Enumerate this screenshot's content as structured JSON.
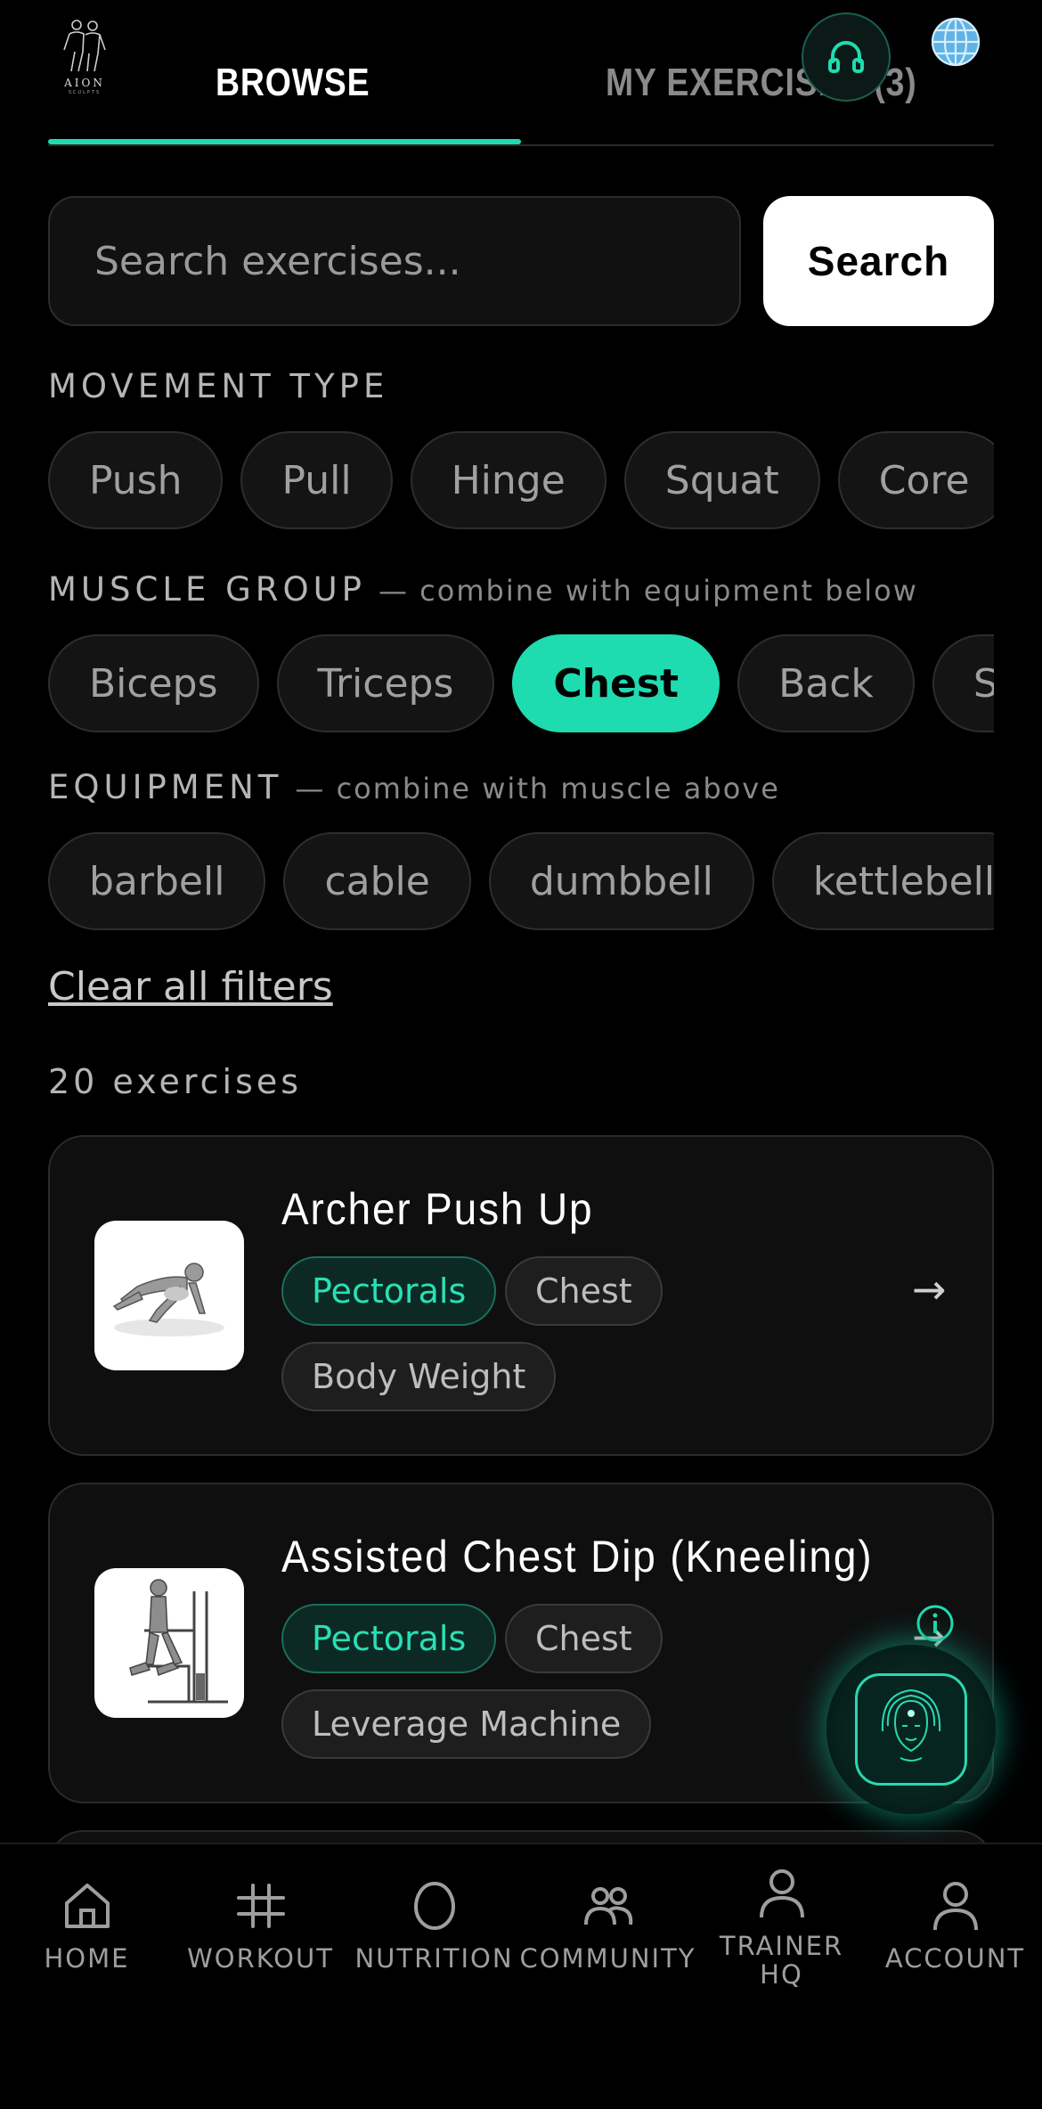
{
  "header": {
    "logo_text": "AION",
    "logo_subtext": "SCULPTS",
    "tabs": [
      {
        "label": "BROWSE",
        "active": true
      },
      {
        "label": "MY EXERCISES (3)",
        "active": false
      }
    ],
    "accent_color": "#1fdcb0"
  },
  "search": {
    "placeholder": "Search exercises...",
    "value": "",
    "button_label": "Search"
  },
  "filters": {
    "movement": {
      "label": "MOVEMENT TYPE",
      "chips": [
        "Push",
        "Pull",
        "Hinge",
        "Squat",
        "Core"
      ]
    },
    "muscle": {
      "label": "MUSCLE GROUP",
      "hint": "— combine with equipment below",
      "chips": [
        "Biceps",
        "Triceps",
        "Chest",
        "Back",
        "Shoulders"
      ],
      "selected": "Chest"
    },
    "equipment": {
      "label": "EQUIPMENT",
      "hint": "— combine with muscle above",
      "chips": [
        "barbell",
        "cable",
        "dumbbell",
        "kettlebell"
      ]
    },
    "clear_label": "Clear all filters"
  },
  "results": {
    "count_label": "20 exercises",
    "items": [
      {
        "title": "Archer Push Up",
        "tags": [
          "Pectorals",
          "Chest",
          "Body Weight"
        ],
        "thumb_icon": "push-up-illustration"
      },
      {
        "title": "Assisted Chest Dip (Kneeling)",
        "tags": [
          "Pectorals",
          "Chest",
          "Leverage Machine"
        ],
        "thumb_icon": "chest-dip-machine-illustration"
      }
    ],
    "arrow": "→"
  },
  "bottom_nav": {
    "items": [
      {
        "label": "HOME",
        "icon": "home-icon"
      },
      {
        "label": "WORKOUT",
        "icon": "workout-icon"
      },
      {
        "label": "NUTRITION",
        "icon": "nutrition-icon"
      },
      {
        "label": "COMMUNITY",
        "icon": "community-icon"
      },
      {
        "label": "TRAINER HQ",
        "icon": "trainer-icon"
      },
      {
        "label": "ACCOUNT",
        "icon": "account-icon"
      }
    ]
  }
}
